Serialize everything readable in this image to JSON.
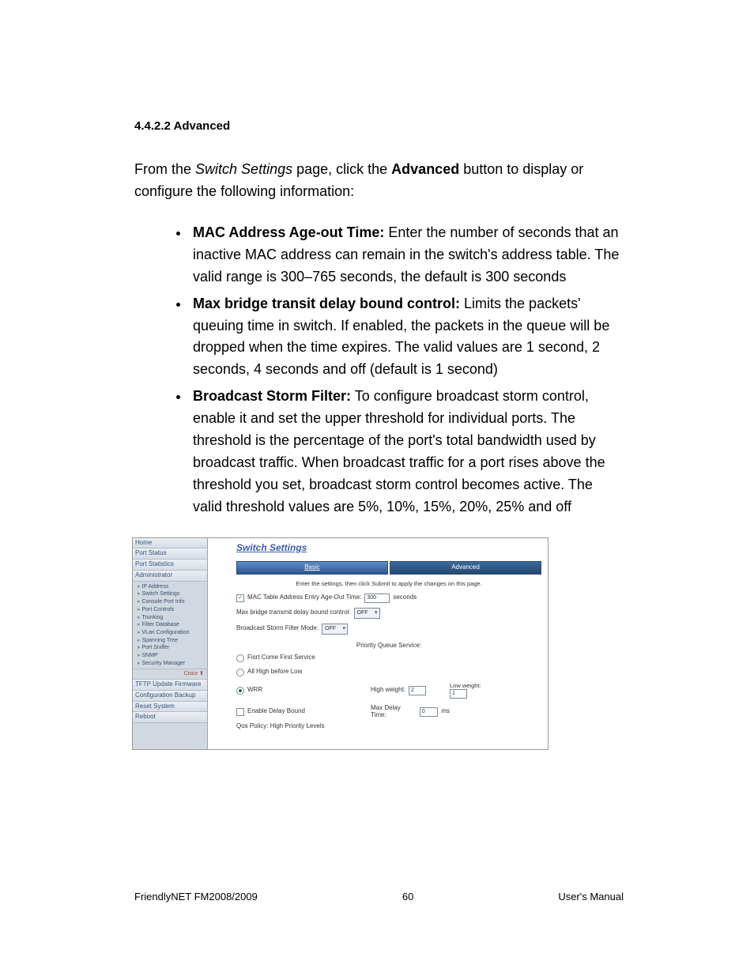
{
  "heading": "4.4.2.2 Advanced",
  "intro": {
    "p1": "From the ",
    "p2_italic": "Switch Settings",
    "p3": " page, click the ",
    "p4_bold": "Advanced",
    "p5": " button to display or configure the following information:"
  },
  "bullets": [
    {
      "label": "MAC Address Age-out Time:",
      "text": " Enter the number of seconds that an inactive MAC address can remain in the switch's address table. The valid range is 300–765 seconds, the default is 300 seconds"
    },
    {
      "label": "Max bridge transit delay bound control:",
      "text": " Limits the packets' queuing time in switch. If enabled, the packets in the queue will be dropped when the time expires. The valid values are 1 second, 2 seconds, 4 seconds and off (default is 1 second)"
    },
    {
      "label": "Broadcast Storm Filter:",
      "text": " To configure broadcast storm control, enable it and set the upper threshold for individual ports. The threshold is the percentage of the port's total bandwidth used by broadcast traffic. When broadcast traffic for a port rises above the threshold you set, broadcast storm control becomes active. The valid threshold values are 5%, 10%, 15%, 20%, 25% and off"
    }
  ],
  "screenshot": {
    "sidebar": {
      "top": [
        "Home",
        "Port Status",
        "Port Statistics"
      ],
      "admin_header": "Administrator",
      "admin_items": [
        "IP Address",
        "Switch Settings",
        "Console Port Info",
        "Port Controls",
        "Trunking",
        "Filter Database",
        "VLan Configuration",
        "Spanning Tree",
        "Port Sniffer",
        "SNMP",
        "Security Manager"
      ],
      "cisco": "Cisco ⬆",
      "bottom": [
        "TFTP Update Firmware",
        "Configuration Backup",
        "Reset System",
        "Reboot"
      ]
    },
    "main": {
      "title": "Switch Settings",
      "tabs": {
        "basic": "Basic",
        "advanced": "Advanced"
      },
      "hint": "Enter the settings, then click Submit to apply the changes on this page.",
      "mac_row": {
        "check": "✓",
        "label": "MAC Table Address Entry Age-Out Time:",
        "value": "300",
        "unit": "seconds"
      },
      "bridge_row": {
        "label": "Max bridge transmit delay bound control:",
        "value": "OFF"
      },
      "bsf_row": {
        "label": "Broadcast Storm Filter Mode:",
        "value": "OFF"
      },
      "pq_title": "Priority Queue Service:",
      "pq": {
        "opt1": "Fisrt Come First Service",
        "opt2": "All High before Low",
        "opt3": "WRR",
        "opt4": "Enable Delay Bound",
        "high_label": "High weight:",
        "high_val": "2",
        "low_label": "Low weight:",
        "low_val": "1",
        "max_label": "Max Delay Time:",
        "max_val": "0",
        "max_unit": "ms"
      },
      "qos": "Qos Policy: High Priority Levels"
    }
  },
  "footer": {
    "left": "FriendlyNET FM2008/2009",
    "center": "60",
    "right": "User's Manual"
  }
}
